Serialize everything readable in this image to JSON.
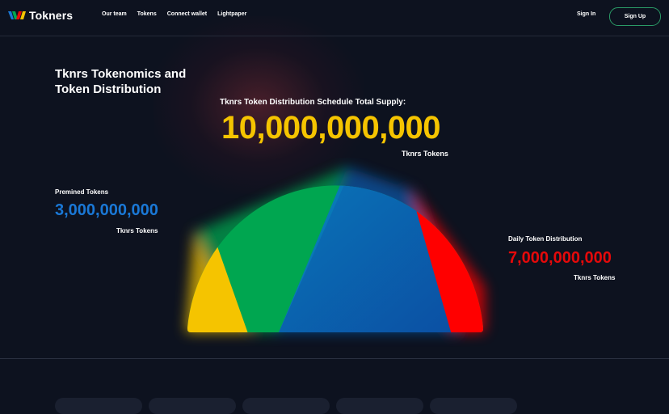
{
  "header": {
    "logo_text": "Tokners",
    "nav": [
      "Our team",
      "Tokens",
      "Connect wallet",
      "Lightpaper"
    ],
    "sign_in": "Sign In",
    "sign_up": "Sign Up"
  },
  "page": {
    "title": "Tknrs Tokenomics and Token Distribution",
    "supply_label": "Tknrs Token Distribution Schedule Total Supply:",
    "supply_value": "10,000,000,000",
    "supply_unit": "Tknrs Tokens"
  },
  "premined": {
    "label": "Premined Tokens",
    "value": "3,000,000,000",
    "unit": "Tknrs Tokens",
    "color": "#1a78d6"
  },
  "daily": {
    "label": "Daily Token Distribution",
    "value": "7,000,000,000",
    "unit": "Tknrs Tokens",
    "color": "#e5090a"
  },
  "colors": {
    "accent_yellow": "#f5c400",
    "green": "#00a650",
    "blue": "#0a57a6",
    "red": "#ff0000",
    "signup_border": "#2a9a66"
  },
  "icons": {
    "logo": "tokners-w-logo-icon"
  }
}
